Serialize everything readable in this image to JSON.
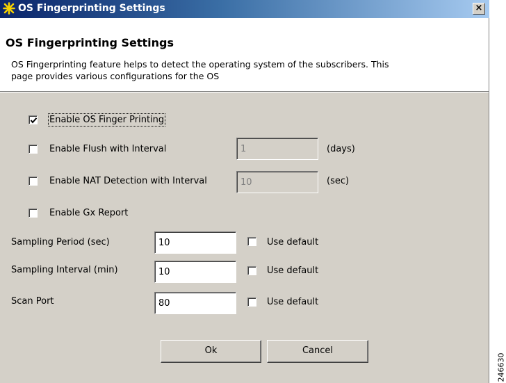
{
  "window": {
    "title": "OS Fingerprinting Settings",
    "close_label": "×"
  },
  "header": {
    "title": "OS Fingerprinting Settings",
    "description": "OS Fingerprinting feature helps to detect the operating system of the subscribers.  This page provides various configurations for the OS"
  },
  "options": {
    "enable_os_fp": {
      "label": "Enable OS Finger Printing",
      "checked": true
    },
    "enable_flush": {
      "label": "Enable Flush with Interval",
      "checked": false,
      "value": "1",
      "unit": "(days)"
    },
    "enable_nat": {
      "label": "Enable NAT Detection with Interval",
      "checked": false,
      "value": "10",
      "unit": "(sec)"
    },
    "enable_gx": {
      "label": "Enable Gx Report",
      "checked": false
    }
  },
  "settings": [
    {
      "label": "Sampling Period (sec)",
      "value": "10",
      "default_label": "Use default",
      "use_default": false
    },
    {
      "label": "Sampling Interval (min)",
      "value": "10",
      "default_label": "Use default",
      "use_default": false
    },
    {
      "label": "Scan Port",
      "value": "80",
      "default_label": "Use default",
      "use_default": false
    }
  ],
  "buttons": {
    "ok": "Ok",
    "cancel": "Cancel"
  },
  "figure_id": "246630",
  "colors": {
    "title_gradient_start": "#0a246a",
    "title_gradient_end": "#a6caf0",
    "dialog_bg": "#d4d0c8"
  }
}
